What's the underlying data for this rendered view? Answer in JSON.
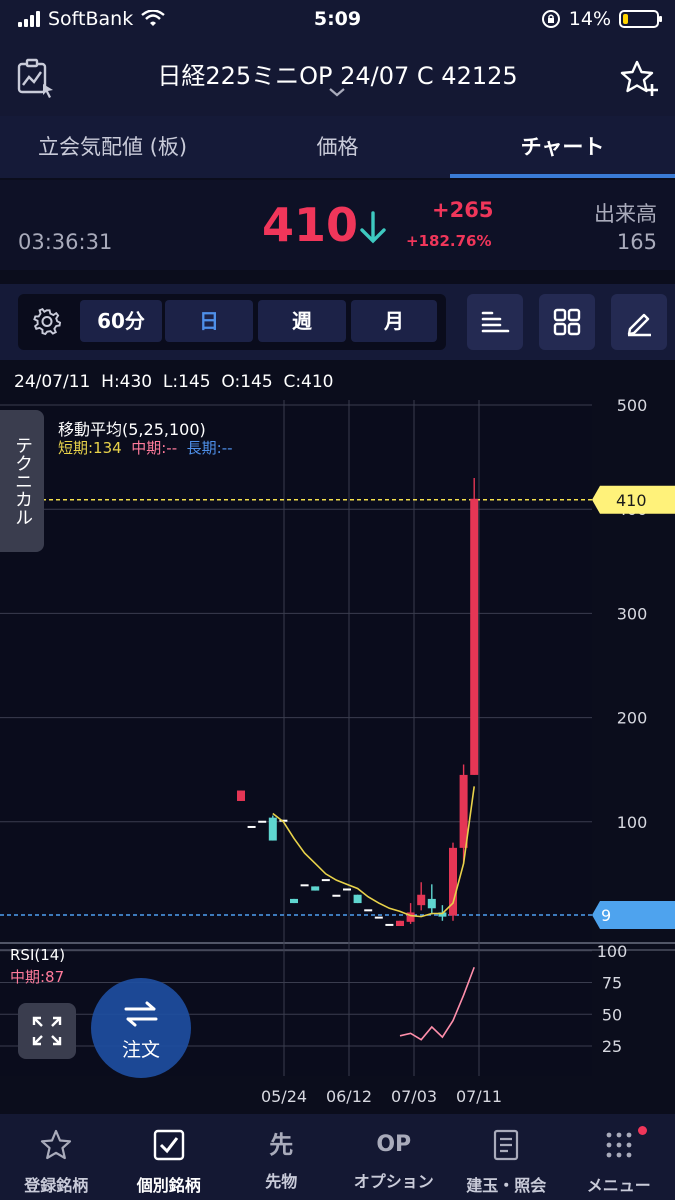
{
  "status": {
    "carrier": "SoftBank",
    "time": "5:09",
    "battery": "14%"
  },
  "header": {
    "title": "日経225ミニOP 24/07 C 42125"
  },
  "tabs": [
    {
      "label": "立会気配値 (板)"
    },
    {
      "label": "価格"
    },
    {
      "label": "チャート",
      "active": true
    }
  ],
  "quote": {
    "time": "03:36:31",
    "price": "410",
    "change": "+265",
    "change_pct": "+182.76%",
    "volume_label": "出来高",
    "volume": "165"
  },
  "toolbar": {
    "interval": "60分",
    "periods": [
      "日",
      "週",
      "月"
    ],
    "selected_period": "日"
  },
  "chart": {
    "ohlc": "24/07/11  H:430  L:145  O:145  C:410",
    "ma_title": "移動平均(5,25,100)",
    "ma_short": "短期:134",
    "ma_mid": "中期:--",
    "ma_long": "長期:--",
    "technical_tab": "テクニカル",
    "rsi_title": "RSI(14)",
    "rsi_mid": "中期:87",
    "current_price_tag": "410",
    "low_tag": "9"
  },
  "chart_data": {
    "type": "candlestick",
    "price_axis": {
      "ticks": [
        100,
        200,
        300,
        400,
        500
      ],
      "range": [
        0,
        500
      ]
    },
    "rsi_axis": {
      "ticks": [
        25,
        50,
        75,
        100
      ]
    },
    "x_ticks": [
      "05/24",
      "06/12",
      "07/03",
      "07/11"
    ],
    "candles": [
      {
        "x": 0,
        "o": 120,
        "c": 130,
        "h": 130,
        "l": 120,
        "dir": "up"
      },
      {
        "x": 1,
        "o": 96,
        "c": 96,
        "h": 96,
        "l": 96,
        "dir": "flat"
      },
      {
        "x": 2,
        "o": 101,
        "c": 101,
        "h": 101,
        "l": 101,
        "dir": "flat"
      },
      {
        "x": 3,
        "o": 104,
        "c": 82,
        "h": 106,
        "l": 82,
        "dir": "down"
      },
      {
        "x": 4,
        "o": 102,
        "c": 102,
        "h": 102,
        "l": 102,
        "dir": "flat"
      },
      {
        "x": 5,
        "o": 26,
        "c": 22,
        "h": 26,
        "l": 22,
        "dir": "down"
      },
      {
        "x": 6,
        "o": 40,
        "c": 40,
        "h": 40,
        "l": 40,
        "dir": "flat"
      },
      {
        "x": 7,
        "o": 38,
        "c": 34,
        "h": 38,
        "l": 34,
        "dir": "down"
      },
      {
        "x": 8,
        "o": 45,
        "c": 45,
        "h": 45,
        "l": 45,
        "dir": "flat"
      },
      {
        "x": 9,
        "o": 30,
        "c": 30,
        "h": 30,
        "l": 30,
        "dir": "flat"
      },
      {
        "x": 10,
        "o": 36,
        "c": 36,
        "h": 36,
        "l": 36,
        "dir": "flat"
      },
      {
        "x": 11,
        "o": 30,
        "c": 22,
        "h": 30,
        "l": 22,
        "dir": "down"
      },
      {
        "x": 12,
        "o": 16,
        "c": 16,
        "h": 16,
        "l": 16,
        "dir": "flat"
      },
      {
        "x": 13,
        "o": 9,
        "c": 9,
        "h": 9,
        "l": 9,
        "dir": "flat"
      },
      {
        "x": 14,
        "o": 2,
        "c": 2,
        "h": 2,
        "l": 2,
        "dir": "flat"
      },
      {
        "x": 15,
        "o": 0,
        "c": 5,
        "h": 5,
        "l": 0,
        "dir": "up"
      },
      {
        "x": 16,
        "o": 4,
        "c": 13,
        "h": 22,
        "l": 2,
        "dir": "up"
      },
      {
        "x": 17,
        "o": 20,
        "c": 30,
        "h": 42,
        "l": 15,
        "dir": "up"
      },
      {
        "x": 18,
        "o": 26,
        "c": 17,
        "h": 40,
        "l": 11,
        "dir": "down"
      },
      {
        "x": 19,
        "o": 13,
        "c": 9,
        "h": 20,
        "l": 5,
        "dir": "down"
      },
      {
        "x": 20,
        "o": 10,
        "c": 75,
        "h": 80,
        "l": 5,
        "dir": "up"
      },
      {
        "x": 21,
        "o": 75,
        "c": 145,
        "h": 155,
        "l": 60,
        "dir": "up"
      },
      {
        "x": 22,
        "o": 145,
        "c": 410,
        "h": 430,
        "l": 145,
        "dir": "up"
      }
    ],
    "ma_short": [
      null,
      null,
      null,
      108,
      100,
      84,
      70,
      60,
      50,
      44,
      40,
      36,
      28,
      22,
      17,
      14,
      10,
      9,
      12,
      12,
      22,
      60,
      134
    ],
    "rsi": [
      {
        "x": 15,
        "v": 33
      },
      {
        "x": 16,
        "v": 35
      },
      {
        "x": 17,
        "v": 30
      },
      {
        "x": 18,
        "v": 40
      },
      {
        "x": 19,
        "v": 32
      },
      {
        "x": 20,
        "v": 45
      },
      {
        "x": 21,
        "v": 65
      },
      {
        "x": 22,
        "v": 87
      }
    ]
  },
  "order_button": {
    "label": "注文"
  },
  "bottom_nav": [
    {
      "label": "登録銘柄",
      "icon": "star-icon"
    },
    {
      "label": "個別銘柄",
      "icon": "check-icon",
      "active": true
    },
    {
      "label": "先物",
      "icon": "futures-icon",
      "glyph": "先"
    },
    {
      "label": "オプション",
      "icon": "option-icon",
      "glyph": "OP"
    },
    {
      "label": "建玉・照会",
      "icon": "document-icon"
    },
    {
      "label": "メニュー",
      "icon": "grid-menu-icon",
      "badge": true
    }
  ]
}
